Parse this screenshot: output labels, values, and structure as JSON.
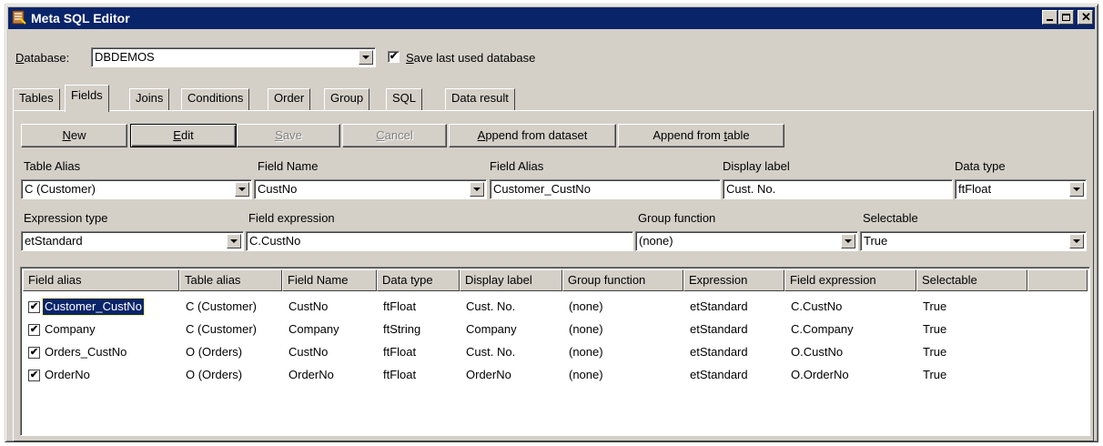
{
  "window": {
    "title": "Meta SQL Editor",
    "icon": "app-icon"
  },
  "database": {
    "label_prefix": "D",
    "label_rest": "atabase:",
    "value": "DBDEMOS",
    "save_last_checked": true,
    "save_last_prefix": "S",
    "save_last_rest": "ave last used database"
  },
  "tabs": [
    {
      "label": "Tables"
    },
    {
      "label": "Fields",
      "active": true
    },
    {
      "label": "Joins"
    },
    {
      "label": "Conditions"
    },
    {
      "label": "Order"
    },
    {
      "label": "Group"
    },
    {
      "label": "SQL"
    },
    {
      "label": "Data result"
    }
  ],
  "toolbar": {
    "new_u": "N",
    "new_rest": "ew",
    "edit_u": "E",
    "edit_rest": "dit",
    "save_u": "S",
    "save_rest": "ave",
    "cancel_u": "C",
    "cancel_rest": "ancel",
    "append_dataset_u": "A",
    "append_dataset_rest": "ppend from dataset",
    "append_table_pre": "Append from ",
    "append_table_u": "t",
    "append_table_rest": "able"
  },
  "editor": {
    "table_alias_label": "Table Alias",
    "table_alias_value": "C (Customer)",
    "field_name_label": "Field Name",
    "field_name_value": "CustNo",
    "field_alias_label": "Field Alias",
    "field_alias_value": "Customer_CustNo",
    "display_label_label": "Display label",
    "display_label_value": "Cust. No.",
    "data_type_label": "Data type",
    "data_type_value": "ftFloat",
    "expression_type_label": "Expression type",
    "expression_type_value": "etStandard",
    "field_expression_label": "Field expression",
    "field_expression_value": "C.CustNo",
    "group_function_label": "Group function",
    "group_function_value": "(none)",
    "selectable_label": "Selectable",
    "selectable_value": "True"
  },
  "grid": {
    "columns": [
      "Field alias",
      "Table alias",
      "Field Name",
      "Data type",
      "Display label",
      "Group function",
      "Expression",
      "Field expression",
      "Selectable"
    ],
    "rows": [
      {
        "checked": true,
        "selected": true,
        "cells": [
          "Customer_CustNo",
          "C (Customer)",
          "CustNo",
          "ftFloat",
          "Cust. No.",
          "(none)",
          "etStandard",
          "C.CustNo",
          "True"
        ]
      },
      {
        "checked": true,
        "selected": false,
        "cells": [
          "Company",
          "C (Customer)",
          "Company",
          "ftString",
          "Company",
          "(none)",
          "etStandard",
          "C.Company",
          "True"
        ]
      },
      {
        "checked": true,
        "selected": false,
        "cells": [
          "Orders_CustNo",
          "O (Orders)",
          "CustNo",
          "ftFloat",
          "Cust. No.",
          "(none)",
          "etStandard",
          "O.CustNo",
          "True"
        ]
      },
      {
        "checked": true,
        "selected": false,
        "cells": [
          "OrderNo",
          "O (Orders)",
          "OrderNo",
          "ftFloat",
          "OrderNo",
          "(none)",
          "etStandard",
          "O.OrderNo",
          "True"
        ]
      }
    ]
  }
}
